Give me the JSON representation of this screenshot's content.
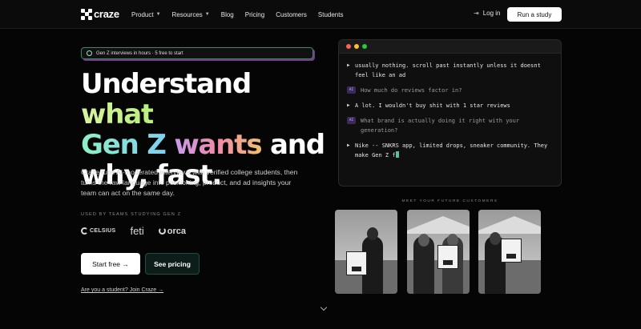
{
  "nav": {
    "logo": "craze",
    "links": [
      {
        "label": "Product",
        "dropdown": true
      },
      {
        "label": "Resources",
        "dropdown": true
      },
      {
        "label": "Blog",
        "dropdown": false
      },
      {
        "label": "Pricing",
        "dropdown": false
      },
      {
        "label": "Customers",
        "dropdown": false
      },
      {
        "label": "Students",
        "dropdown": false
      }
    ],
    "login": "Log in",
    "cta": "Run a study"
  },
  "hero": {
    "badge": "Gen Z interviews in hours · 5 free to start",
    "headline": {
      "part1": "Understand ",
      "part2": "what",
      "part3": "Gen Z",
      "part4": " ",
      "part5": "wants",
      "part6": " and",
      "part7": "why, fast."
    },
    "description": "Craze runs AI-moderated interviews with verified college students, then turns the raw language into positioning, product, and ad insights your team can act on the same day.",
    "used_by": "USED BY TEAMS STUDYING GEN Z",
    "logos": [
      "CELSIUS",
      "feti",
      "orca"
    ],
    "start_free": "Start free →",
    "see_pricing": "See pricing",
    "student_link": "Are you a student? Join Craze →"
  },
  "terminal": {
    "lines": [
      {
        "type": "answer",
        "text": "usually nothing. scroll past instantly unless it doesnt feel like an ad"
      },
      {
        "type": "question",
        "badge": "AI",
        "text": "How much do reviews factor in?"
      },
      {
        "type": "answer",
        "text": "A lot. I wouldn't buy shit with 1 star reviews"
      },
      {
        "type": "question",
        "badge": "AI",
        "text": "What brand is actually doing it right with your generation?"
      },
      {
        "type": "answer",
        "text": "Nike -- SNKRS app, limited drops, sneaker community. They make Gen Z f"
      }
    ],
    "prompt_glyph": "▶"
  },
  "customers": {
    "label": "MEET YOUR FUTURE CUSTOMERS"
  },
  "colors": {
    "background": "#050505",
    "accent_green": "#b9f07a",
    "accent_teal": "#8ff0c4",
    "accent_pink": "#f08aa8",
    "cursor": "#5cc090"
  }
}
